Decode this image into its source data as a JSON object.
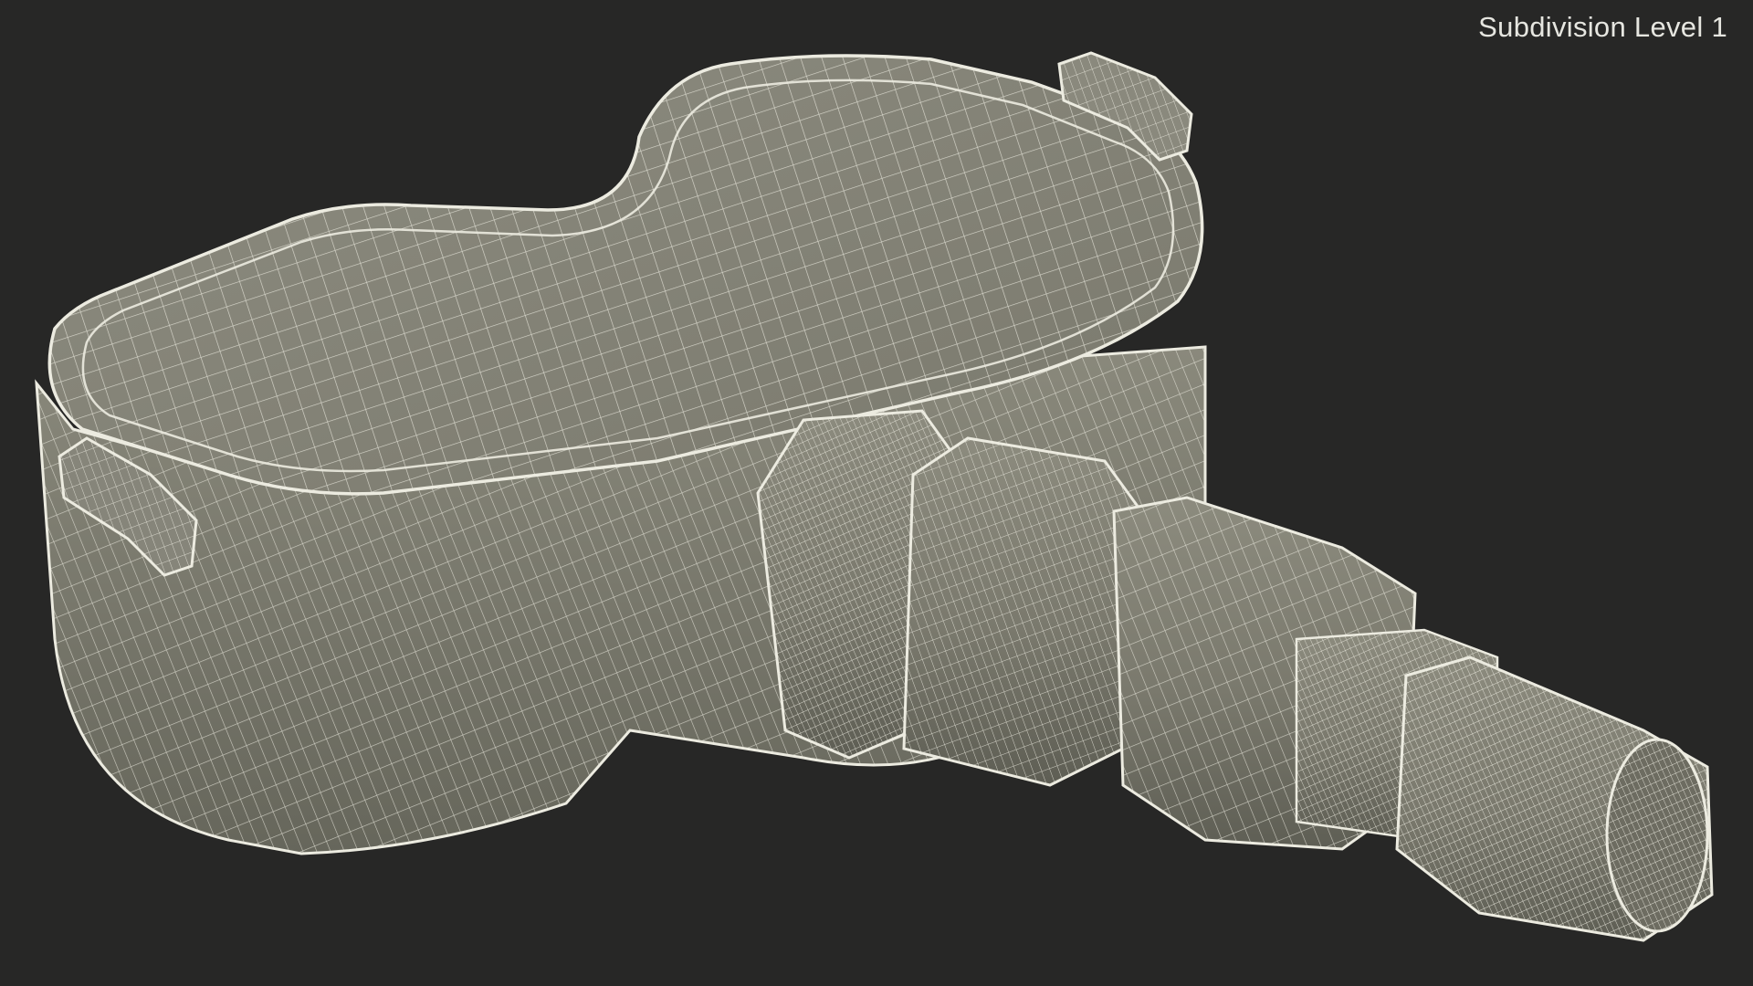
{
  "overlay": {
    "label": "Subdivision Level 1"
  },
  "scene": {
    "subject": "tpms-sensor-wireframe",
    "background_color": "#272726",
    "surface_color": "#807f72",
    "wire_color": "#ecebe0",
    "label_color": "#e6e6e0"
  }
}
